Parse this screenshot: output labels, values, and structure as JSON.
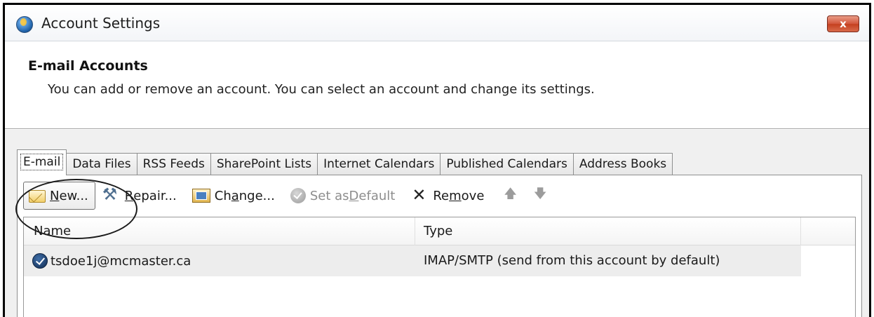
{
  "window": {
    "title": "Account Settings",
    "close_label": "x"
  },
  "header": {
    "title": "E-mail Accounts",
    "description": "You can add or remove an account. You can select an account and change its settings."
  },
  "tabs": [
    {
      "label": "E-mail",
      "active": true
    },
    {
      "label": "Data Files"
    },
    {
      "label": "RSS Feeds"
    },
    {
      "label": "SharePoint Lists"
    },
    {
      "label": "Internet Calendars"
    },
    {
      "label": "Published Calendars"
    },
    {
      "label": "Address Books"
    }
  ],
  "toolbar": {
    "new": {
      "pre": "",
      "key": "N",
      "post": "ew...",
      "icon": "new-mail-icon"
    },
    "repair": {
      "pre": "",
      "key": "R",
      "post": "epair...",
      "icon": "repair-tools-icon"
    },
    "change": {
      "pre": "Ch",
      "key": "a",
      "post": "nge...",
      "icon": "change-settings-icon"
    },
    "set_default": {
      "pre": "Set as ",
      "key": "D",
      "post": "efault",
      "icon": "checkmark-icon",
      "enabled": false
    },
    "remove": {
      "pre": "Re",
      "key": "m",
      "post": "ove",
      "icon": "remove-x-icon"
    },
    "move_up": "🡅",
    "move_down": "🡇"
  },
  "list": {
    "columns": [
      "Name",
      "Type"
    ],
    "rows": [
      {
        "name": "tsdoe1j@mcmaster.ca",
        "type": "IMAP/SMTP (send from this account by default)",
        "icon": "default-account-icon"
      }
    ]
  },
  "colors": {
    "accent_close": "#c4401f",
    "tab_bg": "#f0f0f0",
    "selected_row": "#ededed"
  }
}
